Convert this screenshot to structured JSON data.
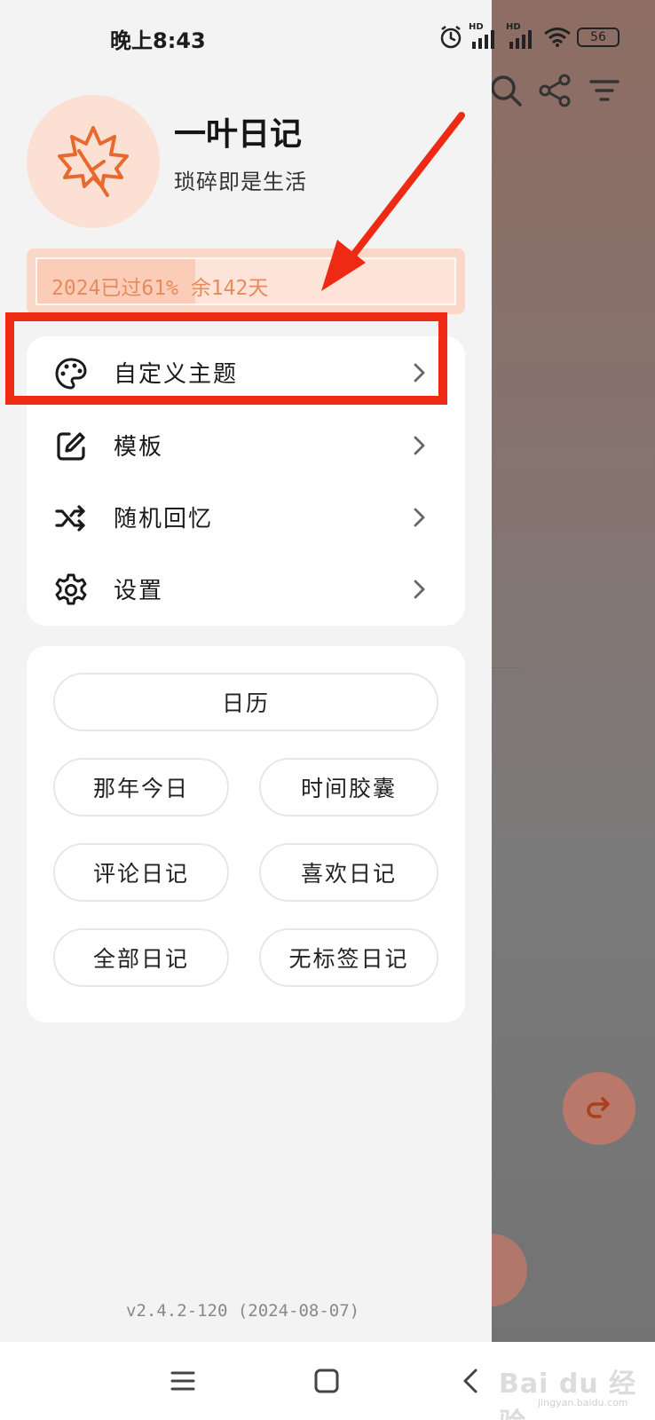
{
  "status_bar": {
    "time": "晚上8:43",
    "battery": "56",
    "hd1": "HD",
    "hd2": "HD"
  },
  "profile": {
    "title": "一叶日记",
    "subtitle": "琐碎即是生活"
  },
  "year_progress": {
    "text": "2024已过61% 余142天",
    "fraction": 0.61
  },
  "menu": {
    "items": [
      {
        "label": "自定义主题",
        "icon": "palette-icon"
      },
      {
        "label": "模板",
        "icon": "edit-icon"
      },
      {
        "label": "随机回忆",
        "icon": "shuffle-icon"
      },
      {
        "label": "设置",
        "icon": "gear-icon"
      }
    ]
  },
  "links": {
    "calendar": "日历",
    "that_day": "那年今日",
    "time_capsule": "时间胶囊",
    "commented": "评论日记",
    "liked": "喜欢日记",
    "all": "全部日记",
    "untagged": "无标签日记"
  },
  "version": "v2.4.2-120 (2024-08-07)",
  "watermark": {
    "text": "Bai du 经验",
    "sub": "jingyan.baidu.com"
  },
  "colors": {
    "accent": "#e8692c",
    "highlight": "#ee2a14",
    "progress_fill": "#fbcdb9"
  }
}
